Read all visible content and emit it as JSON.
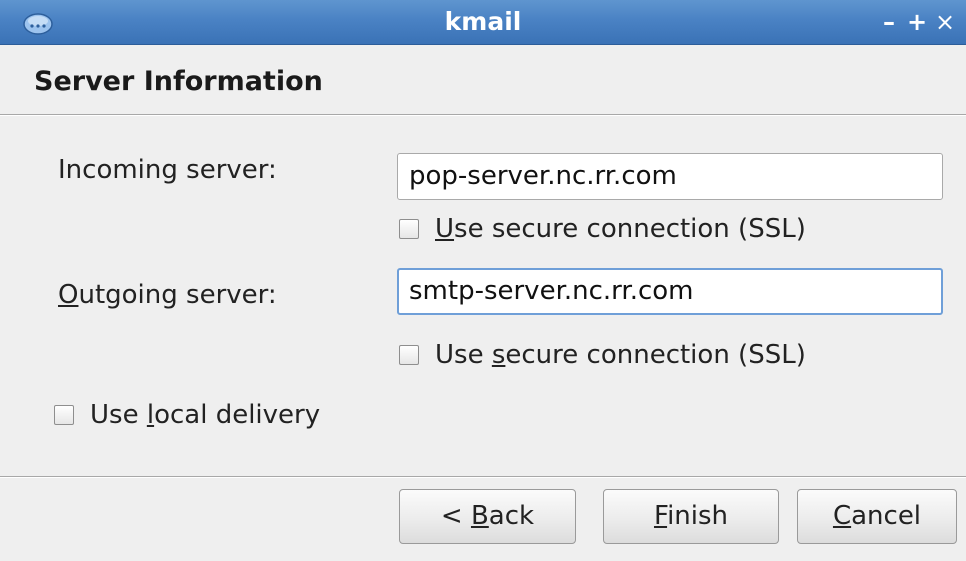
{
  "window": {
    "title": "kmail",
    "controls": {
      "minimize": "–",
      "maximize": "+",
      "close": "×"
    },
    "icon": "kde-app-icon"
  },
  "page": {
    "heading": "Server Information"
  },
  "incoming": {
    "label": "Incoming server:",
    "value": "pop-server.nc.rr.com",
    "ssl": {
      "mnemonic": "U",
      "rest": "se secure connection (SSL)",
      "checked": false
    }
  },
  "outgoing": {
    "label_mnemonic": "O",
    "label_rest": "utgoing server:",
    "value": "smtp-server.nc.rr.com",
    "focused": true,
    "ssl": {
      "pre": "Use ",
      "mnemonic": "s",
      "rest": "ecure connection (SSL)",
      "checked": false
    }
  },
  "local_delivery": {
    "pre": "Use ",
    "mnemonic": "l",
    "rest": "ocal delivery",
    "checked": false
  },
  "buttons": {
    "back": {
      "pre": "< ",
      "mnemonic": "B",
      "rest": "ack"
    },
    "finish": {
      "mnemonic": "F",
      "rest": "inish"
    },
    "cancel": {
      "mnemonic": "C",
      "rest": "ancel"
    }
  },
  "colors": {
    "titlebar": "#4a82c4",
    "focus_border": "#6f9fd8",
    "window_bg": "#efefef"
  }
}
